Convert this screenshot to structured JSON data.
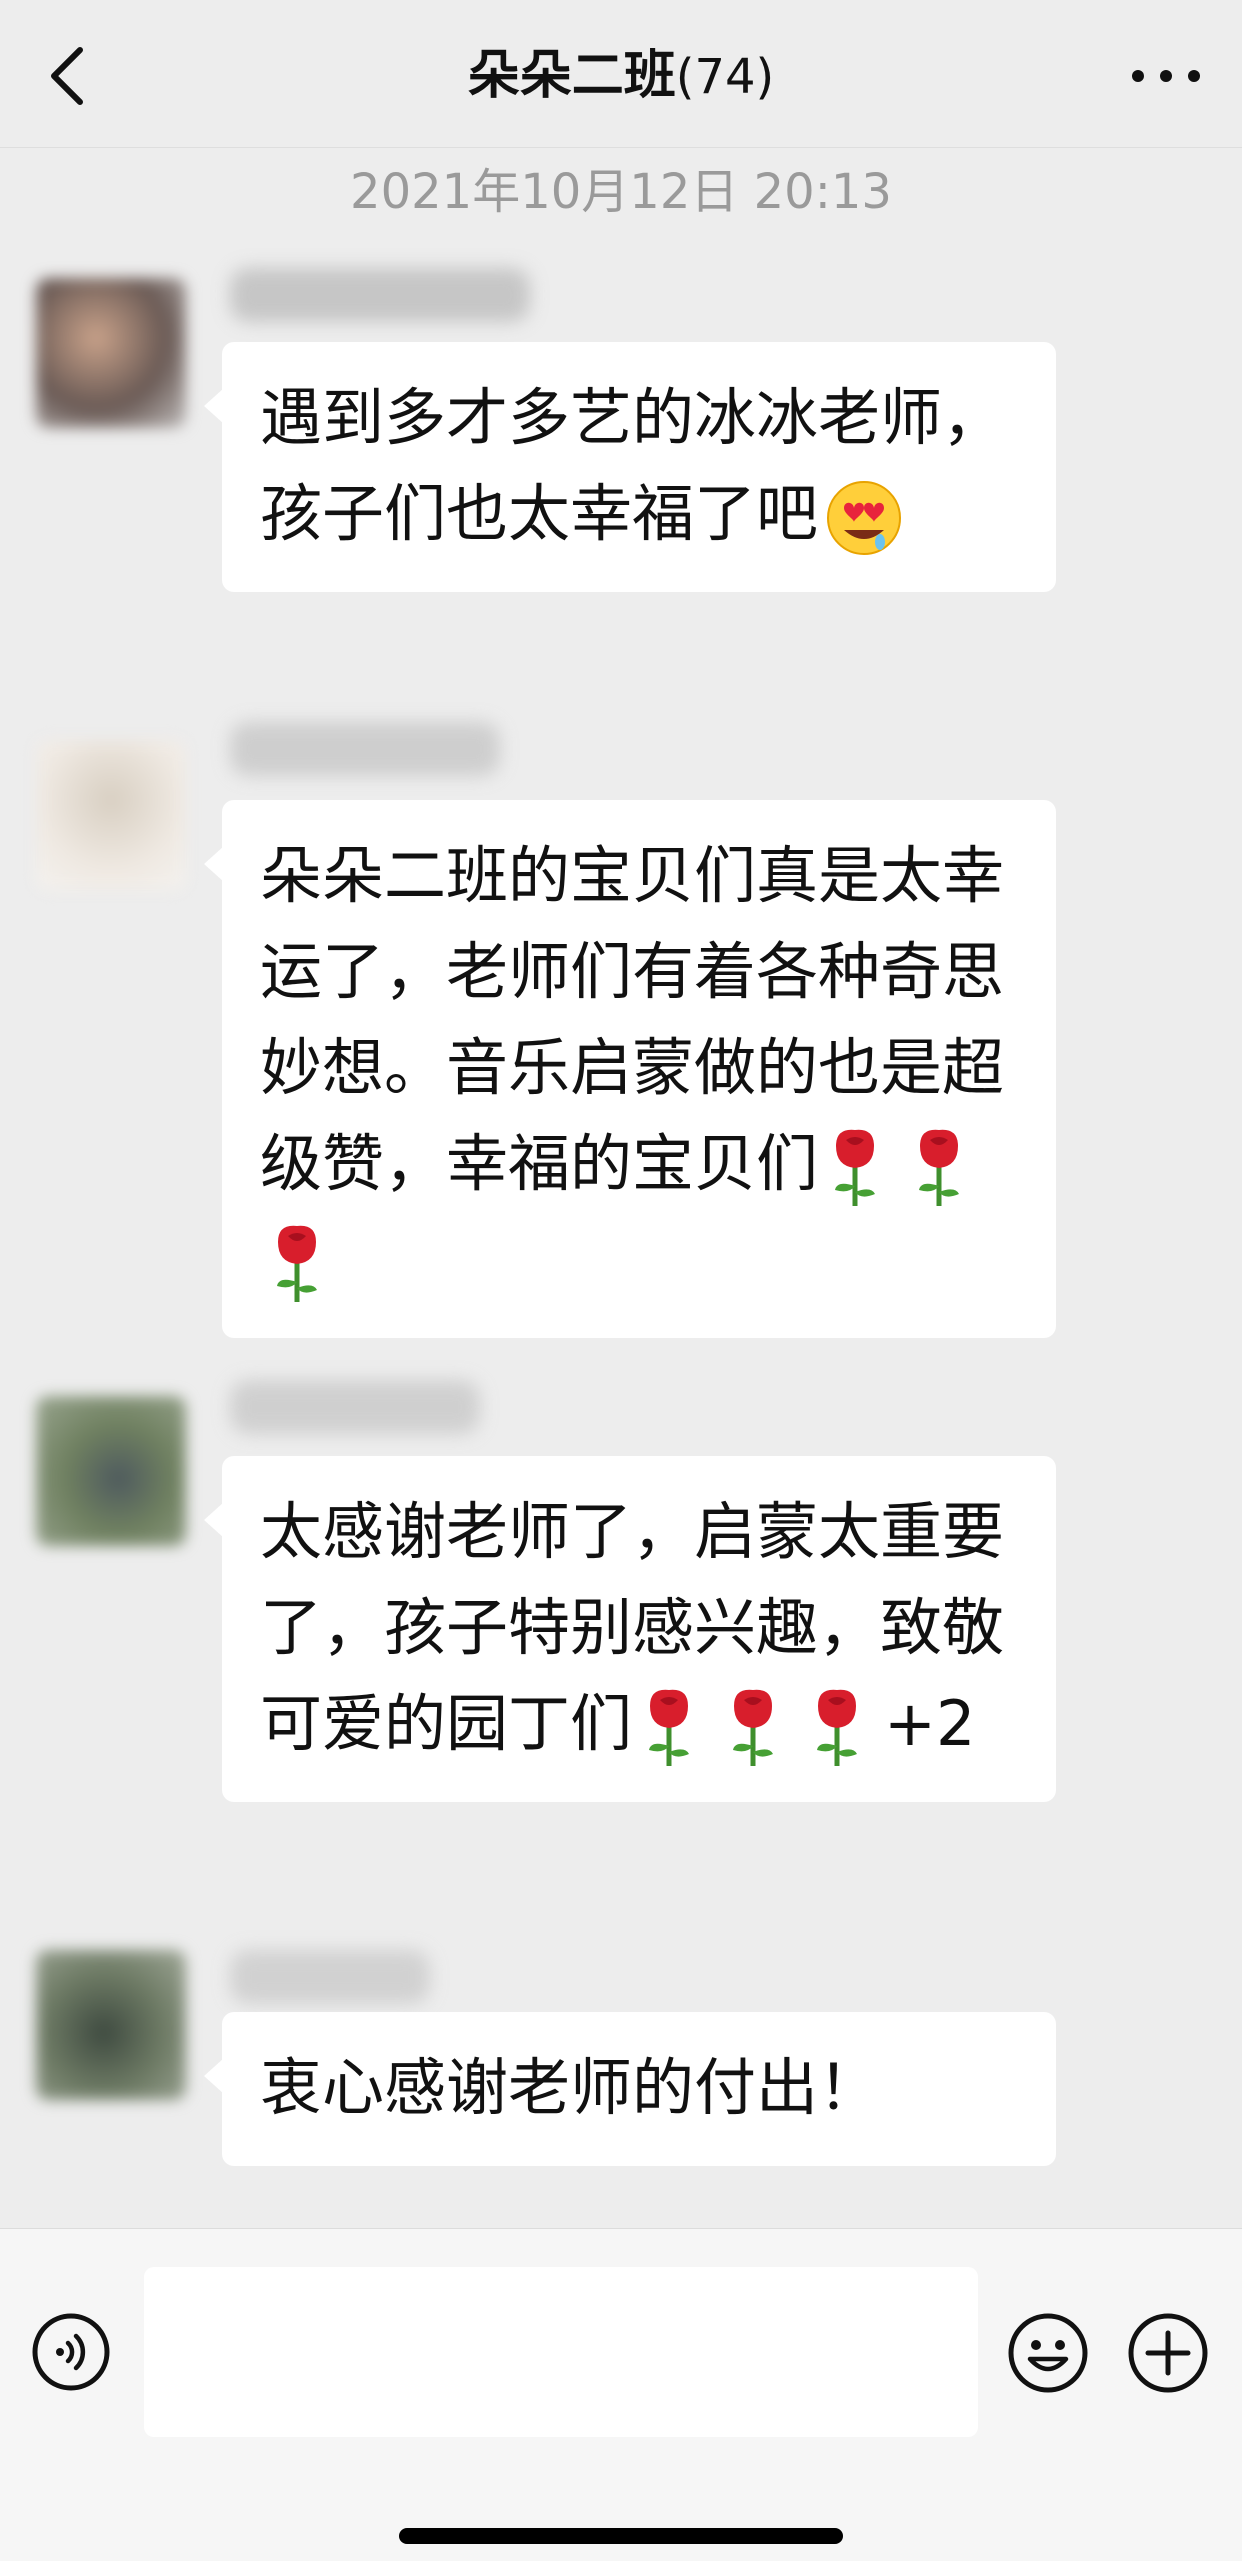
{
  "header": {
    "title": "朵朵二班",
    "member_count": "(74)"
  },
  "timestamp": "2021年10月12日 20:13",
  "messages": [
    {
      "text": "遇到多才多艺的冰冰老师，孩子们也太幸福了吧",
      "emoji": "heart-eyes-face-icon",
      "roses": 0,
      "extra": ""
    },
    {
      "text": "朵朵二班的宝贝们真是太幸运了，老师们有着各种奇思妙想。音乐启蒙做的也是超级赞，幸福的宝贝们",
      "emoji": "",
      "roses": 3,
      "extra": ""
    },
    {
      "text": "太感谢老师了，启蒙太重要了，孩子特别感兴趣，致敬可爱的园丁们",
      "emoji": "",
      "roses": 3,
      "extra": "+2"
    },
    {
      "text": "衷心感谢老师的付出！",
      "emoji": "",
      "roses": 0,
      "extra": ""
    }
  ],
  "input": {
    "value": "",
    "placeholder": ""
  },
  "icons": {
    "back": "chevron-left-icon",
    "more": "more-dots-icon",
    "voice": "voice-icon",
    "emoji": "emoji-icon",
    "plus": "plus-icon",
    "rose": "rose-icon"
  },
  "colors": {
    "background": "#ededed",
    "bubble": "#ffffff",
    "timestamp": "#9a9a9a",
    "input_bar": "#f6f6f6"
  }
}
